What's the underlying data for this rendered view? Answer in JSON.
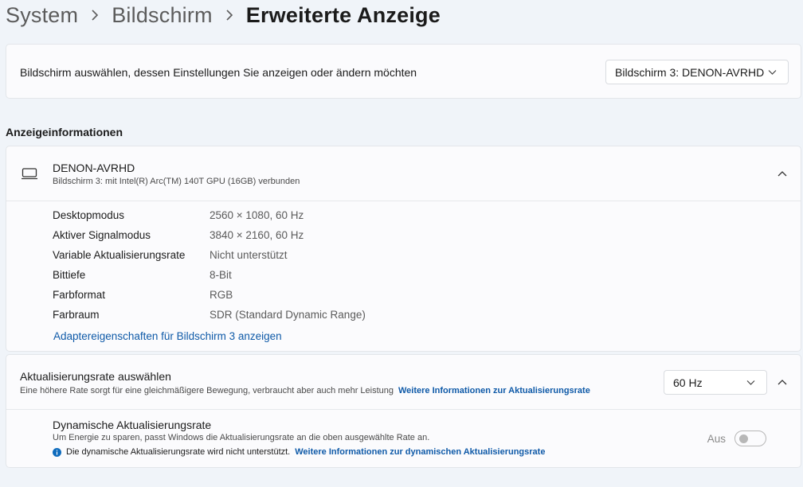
{
  "breadcrumb": {
    "items": [
      "System",
      "Bildschirm",
      "Erweiterte Anzeige"
    ]
  },
  "display_select": {
    "label": "Bildschirm auswählen, dessen Einstellungen Sie anzeigen oder ändern möchten",
    "selected": "Bildschirm 3: DENON-AVRHD"
  },
  "display_info": {
    "section_title": "Anzeigeinformationen",
    "device_name": "DENON-AVRHD",
    "device_subtitle": "Bildschirm 3: mit Intel(R) Arc(TM) 140T GPU (16GB) verbunden",
    "rows": [
      {
        "key": "Desktopmodus",
        "value": "2560 × 1080, 60 Hz"
      },
      {
        "key": "Aktiver Signalmodus",
        "value": "3840 × 2160, 60 Hz"
      },
      {
        "key": "Variable Aktualisierungsrate",
        "value": "Nicht unterstützt"
      },
      {
        "key": "Bittiefe",
        "value": "8-Bit"
      },
      {
        "key": "Farbformat",
        "value": "RGB"
      },
      {
        "key": "Farbraum",
        "value": "SDR (Standard Dynamic Range)"
      }
    ],
    "adapter_link": "Adaptereigenschaften für Bildschirm 3 anzeigen"
  },
  "refresh_rate": {
    "title": "Aktualisierungsrate auswählen",
    "subtitle": "Eine höhere Rate sorgt für eine gleichmäßigere Bewegung, verbraucht aber auch mehr Leistung",
    "more_link": "Weitere Informationen zur Aktualisierungsrate",
    "selected": "60 Hz"
  },
  "dynamic_refresh": {
    "title": "Dynamische Aktualisierungsrate",
    "subtitle": "Um Energie zu sparen, passt Windows die Aktualisierungsrate an die oben ausgewählte Rate an.",
    "note": "Die dynamische Aktualisierungsrate wird nicht unterstützt.",
    "note_link": "Weitere Informationen zur dynamischen Aktualisierungsrate",
    "toggle_label": "Aus",
    "toggle_on": false
  },
  "colors": {
    "accent_link": "#0f5aa8",
    "background": "#f0f4f9",
    "card": "#fbfbfd"
  }
}
